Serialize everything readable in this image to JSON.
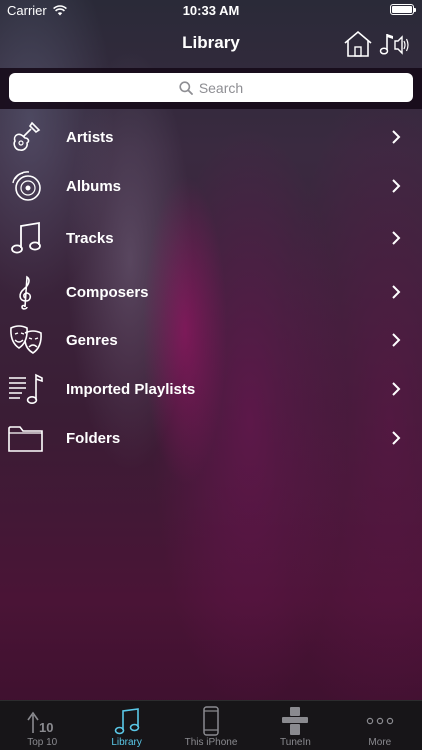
{
  "status": {
    "carrier": "Carrier",
    "time": "10:33 AM"
  },
  "nav": {
    "title": "Library"
  },
  "search": {
    "placeholder": "Search"
  },
  "library": {
    "items": [
      {
        "label": "Artists",
        "icon": "guitar-icon"
      },
      {
        "label": "Albums",
        "icon": "disc-icon"
      },
      {
        "label": "Tracks",
        "icon": "music-note-icon"
      },
      {
        "label": "Composers",
        "icon": "treble-clef-icon"
      },
      {
        "label": "Genres",
        "icon": "theater-masks-icon"
      },
      {
        "label": "Imported Playlists",
        "icon": "playlist-icon"
      },
      {
        "label": "Folders",
        "icon": "folder-icon"
      }
    ]
  },
  "tabs": [
    {
      "label": "Top 10",
      "icon": "top10-icon",
      "active": false
    },
    {
      "label": "Library",
      "icon": "music-note-icon",
      "active": true
    },
    {
      "label": "This iPhone",
      "icon": "phone-icon",
      "active": false
    },
    {
      "label": "TuneIn",
      "icon": "tunein-icon",
      "active": false
    },
    {
      "label": "More",
      "icon": "more-icon",
      "active": false
    }
  ],
  "colors": {
    "accent": "#5ac8e8",
    "tab_inactive": "#8a8a8f"
  }
}
